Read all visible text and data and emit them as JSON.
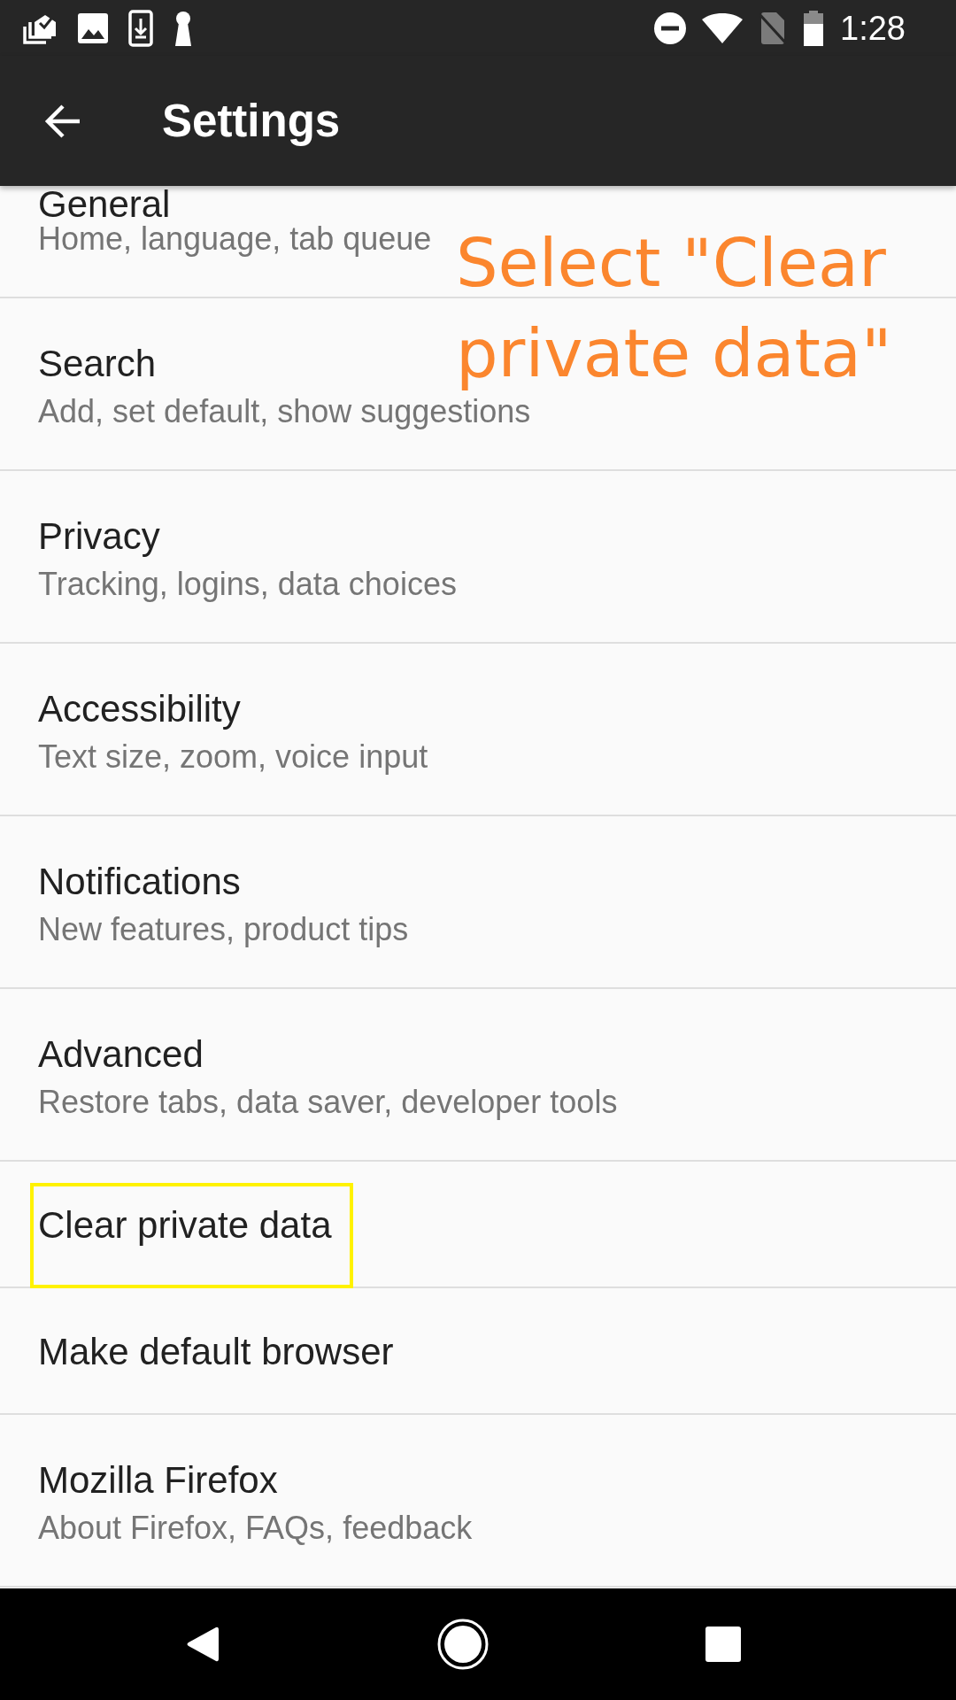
{
  "status_bar": {
    "time": "1:28"
  },
  "app_bar": {
    "title": "Settings"
  },
  "settings_list": [
    {
      "title": "General",
      "subtitle": "Home, language, tab queue",
      "highlighted": false
    },
    {
      "title": "Search",
      "subtitle": "Add, set default, show suggestions",
      "highlighted": false
    },
    {
      "title": "Privacy",
      "subtitle": "Tracking, logins, data choices",
      "highlighted": false
    },
    {
      "title": "Accessibility",
      "subtitle": "Text size, zoom, voice input",
      "highlighted": false
    },
    {
      "title": "Notifications",
      "subtitle": "New features, product tips",
      "highlighted": false
    },
    {
      "title": "Advanced",
      "subtitle": "Restore tabs, data saver, developer tools",
      "highlighted": false
    },
    {
      "title": "Clear private data",
      "highlighted": true
    },
    {
      "title": "Make default browser",
      "highlighted": false
    },
    {
      "title": "Mozilla Firefox",
      "subtitle": "About Firefox, FAQs, feedback",
      "highlighted": false
    }
  ],
  "annotation": {
    "text": "Select \"Clear private data\""
  }
}
